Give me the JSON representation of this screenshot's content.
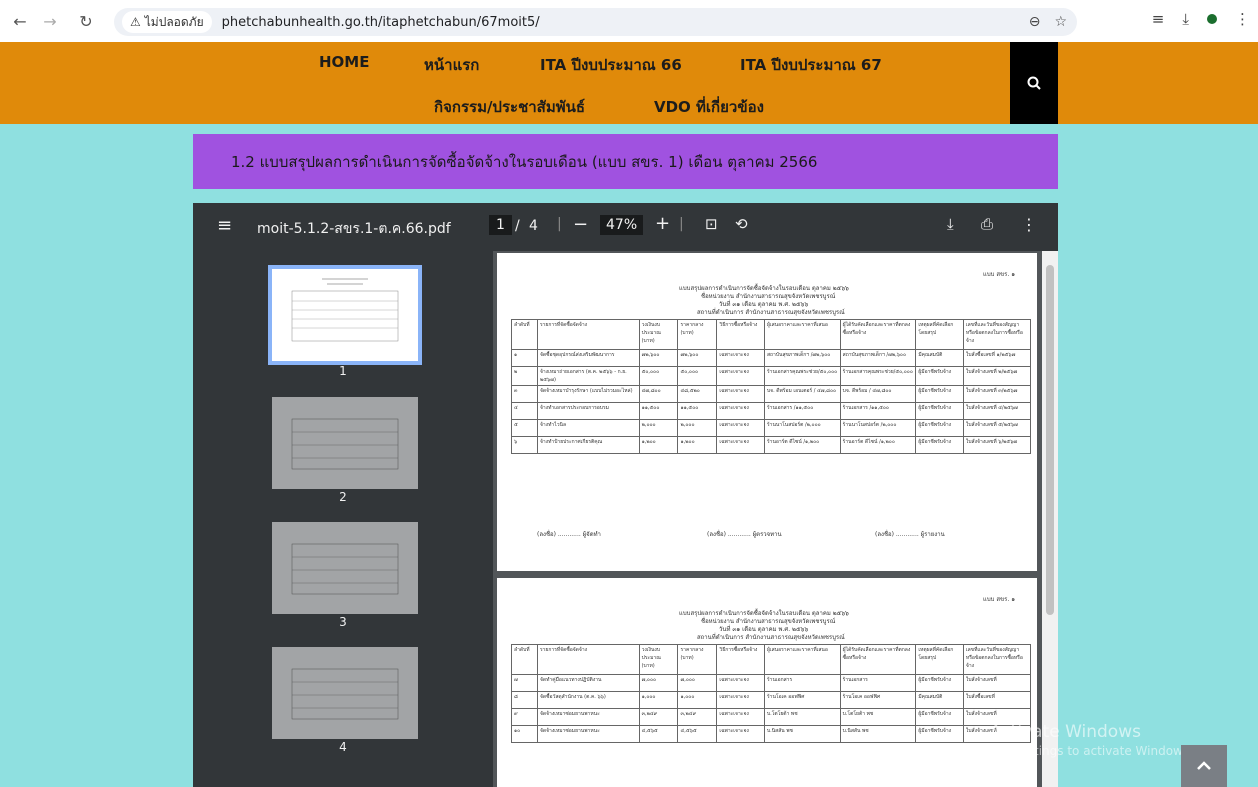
{
  "browser": {
    "security_label": "ไม่ปลอดภัย",
    "url": "phetchabunhealth.go.th/itaphetchabun/67moit5/"
  },
  "nav": {
    "home": "HOME",
    "main_page": "หน้าแรก",
    "ita66": "ITA ปีงบประมาณ 66",
    "ita67": "ITA ปีงบประมาณ 67",
    "activities": "กิจกรรม/ประชาสัมพันธ์",
    "vdo": "VDO ที่เกี่ยวข้อง"
  },
  "banner": "1.2 แบบสรุปผลการดำเนินการจัดซื้อจัดจ้างในรอบเดือน (แบบ สขร. 1) เดือน ตุลาคม 2566",
  "pdf": {
    "filename": "moit-5.1.2-สขร.1-ต.ค.66.pdf",
    "page_current": "1",
    "page_sep": "/",
    "page_total": "4",
    "zoom": "47%",
    "thumb_labels": [
      "1",
      "2",
      "3",
      "4"
    ]
  },
  "doc": {
    "form_code": "แบบ สขร. ๑",
    "title_line1": "แบบสรุปผลการดำเนินการจัดซื้อจัดจ้างในรอบเดือน ตุลาคม ๒๕๖๖",
    "title_line2": "ชื่อหน่วยงาน สำนักงานสาธารณสุขจังหวัดเพชรบูรณ์",
    "title_line3": "วันที่ ๓๑ เดือน ตุลาคม พ.ศ. ๒๕๖๖",
    "title_line4": "สถานที่ดำเนินการ สำนักงานสาธารณสุขจังหวัดเพชรบูรณ์",
    "headers": [
      "ลำดับที่",
      "รายการที่จัดซื้อจัดจ้าง",
      "วงเงินงบประมาณ (บาท)",
      "ราคากลาง (บาท)",
      "วิธีการซื้อหรือจ้าง",
      "ผู้เสนอราคาและราคาที่เสนอ",
      "ผู้ได้รับคัดเลือกและราคาที่ตกลงซื้อหรือจ้าง",
      "เหตุผลที่คัดเลือกโดยสรุป",
      "เลขที่และวันที่ของสัญญาหรือข้อตกลงในการซื้อหรือจ้าง"
    ],
    "rows": [
      [
        "๑",
        "จัดซื้อชุดอุปกรณ์ส่งเสริมพัฒนาการ",
        "๗๒,๖๐๐",
        "๗๒,๖๐๐",
        "เฉพาะเจาะจง",
        "สถาบันสุขภาพเด็กฯ /๗๒,๖๐๐",
        "สถาบันสุขภาพเด็กฯ /๗๒,๖๐๐",
        "มีคุณสมบัติ",
        "ใบสั่งซื้อเลขที่ ๑/๒๕๖๗"
      ],
      [
        "๒",
        "จ้างเหมาถ่ายเอกสาร (ต.ค. ๒๕๖๖ - ก.ย. ๒๕๖๗)",
        "๕๐,๐๐๐",
        "๕๐,๐๐๐",
        "เฉพาะเจาะจง",
        "ร้านเอกสารคุณพระช่วย/๕๐,๐๐๐",
        "ร้านเอกสารคุณพระช่วย/๕๐,๐๐๐",
        "ผู้มีอาชีพรับจ้าง",
        "ใบสั่งจ้างเลขที่ ๒/๒๕๖๗"
      ],
      [
        "๓",
        "จัดจ้างเหมาบำรุงรักษา (แบบไม่รวมอะไหล่)",
        "๔๗,๘๐๐",
        "๔๘,๕๒๐",
        "เฉพาะเจาะจง",
        "บจ. ดีพร้อม เอนเตอร์ / ๔๗,๘๐๐",
        "บจ. ดีพร้อม / ๔๗,๘๐๐",
        "ผู้มีอาชีพรับจ้าง",
        "ใบสั่งจ้างเลขที่ ๓/๒๕๖๗"
      ],
      [
        "๔",
        "จ้างทำเอกสารประกอบการอบรม",
        "๑๑,๕๐๐",
        "๑๑,๕๐๐",
        "เฉพาะเจาะจง",
        "ร้านเอกสาร /๑๑,๕๐๐",
        "ร้านเอกสาร /๑๑,๕๐๐",
        "ผู้มีอาชีพรับจ้าง",
        "ใบสั่งจ้างเลขที่ ๔/๒๕๖๗"
      ],
      [
        "๕",
        "จ้างทำไวนิล",
        "๒,๐๐๐",
        "๒,๐๐๐",
        "เฉพาะเจาะจง",
        "ร้านนาโนสปอร์ต /๒,๐๐๐",
        "ร้านนาโนสปอร์ต /๒,๐๐๐",
        "ผู้มีอาชีพรับจ้าง",
        "ใบสั่งจ้างเลขที่ ๕/๒๕๖๗"
      ],
      [
        "๖",
        "จ้างทำป้ายประกาศเกียรติคุณ",
        "๑,๒๐๐",
        "๑,๒๐๐",
        "เฉพาะเจาะจง",
        "ร้านอาร์ต ดีไซน์ /๑,๒๐๐",
        "ร้านอาร์ต ดีไซน์ /๑,๒๐๐",
        "ผู้มีอาชีพรับจ้าง",
        "ใบสั่งจ้างเลขที่ ๖/๒๕๖๗"
      ]
    ],
    "sign1": "(ลงชื่อ) ............ ผู้จัดทำ",
    "sign2": "(ลงชื่อ) ............ ผู้ตรวจทาน",
    "sign3": "(ลงชื่อ) ............ ผู้รายงาน"
  },
  "page2_rows": [
    [
      "๗",
      "จัดทำคู่มือแนวทางปฏิบัติงาน",
      "๗,๐๐๐",
      "๗,๐๐๐",
      "เฉพาะเจาะจง",
      "ร้านเอกสาร",
      "ร้านเอกสาร",
      "ผู้มีอาชีพรับจ้าง",
      "ใบสั่งจ้างเลขที่"
    ],
    [
      "๘",
      "จัดซื้อวัสดุสำนักงาน (ต.ค. ๖๖)",
      "๑,๐๐๐",
      "๑,๐๐๐",
      "เฉพาะเจาะจง",
      "ร้านโอเค ออฟฟิศ",
      "ร้านโอเค ออฟฟิศ",
      "มีคุณสมบัติ",
      "ใบสั่งซื้อเลขที่"
    ],
    [
      "๙",
      "จัดจ้างเหมาซ่อมยานพาหนะ",
      "๓,๒๔๙",
      "๓,๒๔๙",
      "เฉพาะเจาะจง",
      "บ.โตโยต้า พช",
      "บ.โตโยต้า พช",
      "ผู้มีอาชีพรับจ้าง",
      "ใบสั่งจ้างเลขที่"
    ],
    [
      "๑๐",
      "จัดจ้างเหมาซ่อมยานพาหนะ",
      "๔,๕๖๕",
      "๔,๕๖๕",
      "เฉพาะเจาะจง",
      "บ.นิสสัน พช",
      "บ.นิสสัน พช",
      "ผู้มีอาชีพรับจ้าง",
      "ใบสั่งจ้างเลขที่"
    ]
  ],
  "watermark": {
    "line1": "Activate Windows",
    "line2": "Go to Settings to activate Windows."
  }
}
